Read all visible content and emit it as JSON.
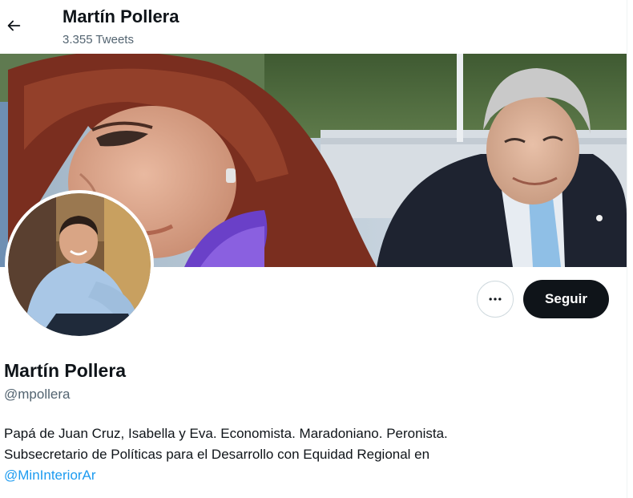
{
  "header": {
    "back_icon": "arrow-left-icon",
    "title": "Martín Pollera",
    "tweet_count": "3.355 Tweets"
  },
  "banner": {
    "description_icon": "banner-photo"
  },
  "actions": {
    "more_icon": "more-horizontal-icon",
    "follow_label": "Seguir"
  },
  "profile": {
    "name": "Martín Pollera",
    "handle": "@mpollera",
    "bio_line1": "Papá de Juan Cruz, Isabella y Eva. Economista. Maradoniano. Peronista.",
    "bio_line2": "Subsecretario de Políticas para el Desarrollo con Equidad Regional en",
    "bio_link": "@MinInteriorAr"
  },
  "colors": {
    "text_primary": "#0f1419",
    "text_secondary": "#536471",
    "link": "#1d9bf0",
    "follow_button_bg": "#0f1419",
    "border": "#cfd9de"
  }
}
